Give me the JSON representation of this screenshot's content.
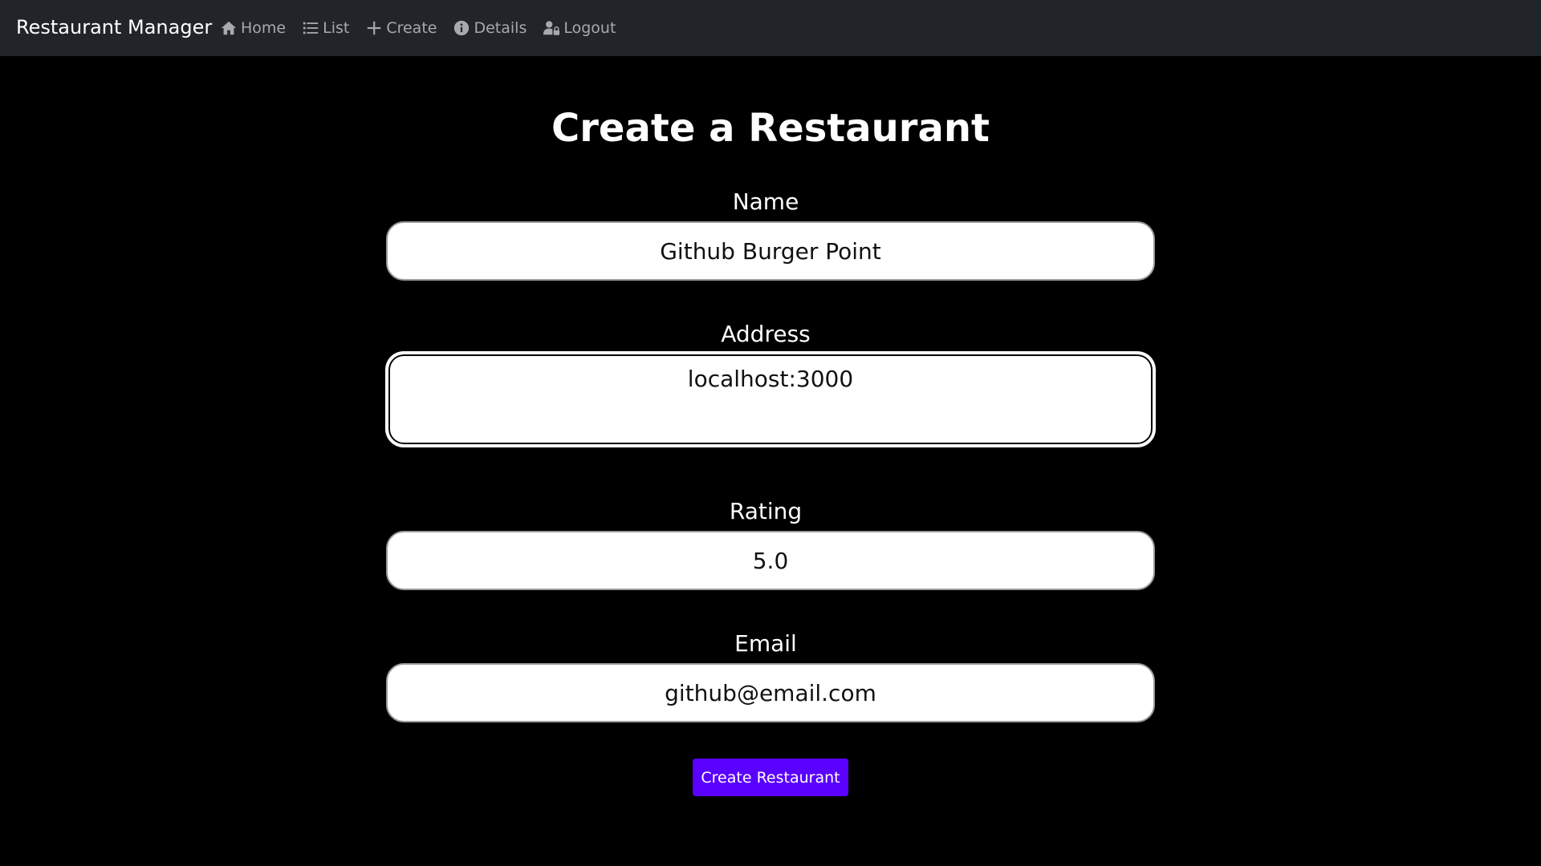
{
  "navbar": {
    "brand": "Restaurant Manager",
    "links": [
      {
        "label": "Home",
        "icon": "home-icon"
      },
      {
        "label": "List",
        "icon": "list-icon"
      },
      {
        "label": "Create",
        "icon": "plus-icon"
      },
      {
        "label": "Details",
        "icon": "info-icon"
      },
      {
        "label": "Logout",
        "icon": "user-lock-icon"
      }
    ]
  },
  "page": {
    "title": "Create a Restaurant"
  },
  "form": {
    "name": {
      "label": "Name",
      "value": "Github Burger Point"
    },
    "address": {
      "label": "Address",
      "value": "localhost:3000"
    },
    "rating": {
      "label": "Rating",
      "value": "5.0"
    },
    "email": {
      "label": "Email",
      "value": "github@email.com"
    },
    "submit_label": "Create Restaurant"
  },
  "colors": {
    "navbar_bg": "#212529",
    "page_bg": "#000000",
    "button_bg": "#5a00ff"
  }
}
